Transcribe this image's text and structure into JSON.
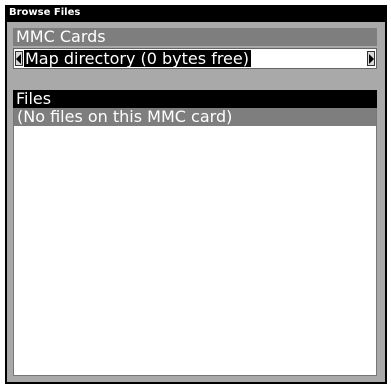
{
  "window": {
    "title": "Browse Files"
  },
  "mmc_cards": {
    "header": "MMC Cards",
    "selected_value": "Map directory  (0 bytes free)",
    "left_arrow_icon": "arrow-left-icon",
    "right_arrow_icon": "arrow-right-icon"
  },
  "files": {
    "header": "Files",
    "items": [
      {
        "label": "(No files on this MMC card)"
      }
    ]
  },
  "colors": {
    "title_bar": "#000000",
    "panel_background": "#a9a9a9",
    "section_header_gray": "#7e7e7e",
    "section_header_black": "#000000",
    "list_background": "#ffffff",
    "highlight_text": "#ffffff"
  }
}
